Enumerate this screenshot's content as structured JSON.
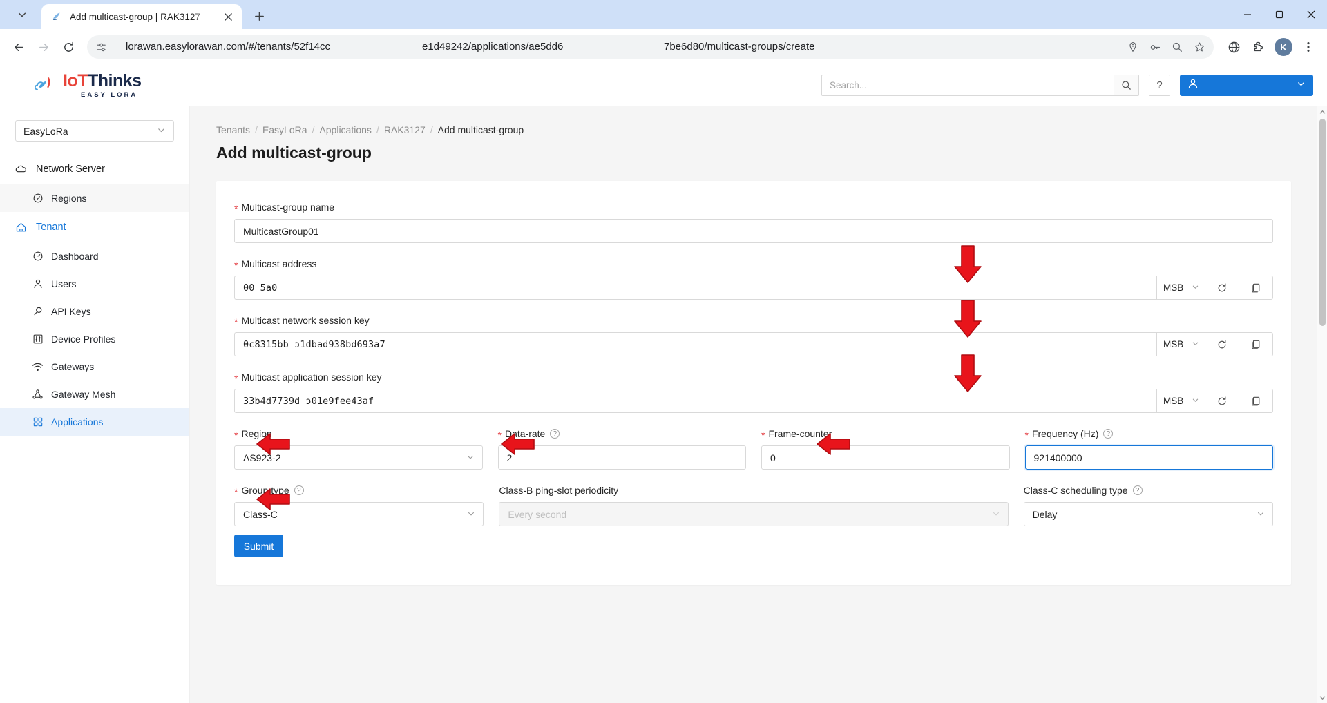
{
  "browser": {
    "tab": {
      "title": "Add multicast-group | RAK3127",
      "favicon_icon": "app-favicon"
    },
    "new_tab_label": "+",
    "window": {
      "minimize": "minimize-icon",
      "maximize": "maximize-icon",
      "close": "close-icon"
    },
    "nav": {
      "back": "back-arrow-icon",
      "forward": "forward-arrow-icon",
      "reload": "reload-icon"
    },
    "url": {
      "segment1": "lorawan.easylorawan.com/#/tenants/52f14cc",
      "segment2": "e1d49242/applications/ae5dd6",
      "segment3": "7be6d80/multicast-groups/create",
      "site_info_icon": "site-settings-icon"
    },
    "omnibox_icons": [
      "location-icon",
      "password-key-icon",
      "zoom-icon",
      "bookmark-star-icon"
    ],
    "toolbar_icons": [
      "globe-icon",
      "extensions-puzzle-icon"
    ],
    "profile": {
      "initial": "K"
    },
    "menu_icon": "three-dot-menu-icon"
  },
  "app": {
    "logo": {
      "main_part1": "IoT",
      "main_part2": "Thinks",
      "sub": "EASY LORA"
    },
    "search": {
      "placeholder": "Search...",
      "value": "",
      "button_icon": "search-icon"
    },
    "help_label": "?",
    "user_menu": {
      "avatar_icon": "user-icon",
      "chevron_icon": "chevron-down-icon"
    }
  },
  "sidebar": {
    "tenant_select": {
      "value": "EasyLoRa",
      "chevron_icon": "chevron-down-icon"
    },
    "groups": [
      {
        "label": "Network Server",
        "icon": "cloud-icon",
        "active": false,
        "items": [
          {
            "label": "Regions",
            "icon": "compass-icon",
            "selected": false,
            "highlight": true
          }
        ]
      },
      {
        "label": "Tenant",
        "icon": "home-icon",
        "active": true,
        "items": [
          {
            "label": "Dashboard",
            "icon": "gauge-icon",
            "selected": false,
            "highlight": false
          },
          {
            "label": "Users",
            "icon": "user-icon",
            "selected": false,
            "highlight": false
          },
          {
            "label": "API Keys",
            "icon": "key-search-icon",
            "selected": false,
            "highlight": false
          },
          {
            "label": "Device Profiles",
            "icon": "sliders-icon",
            "selected": false,
            "highlight": false
          },
          {
            "label": "Gateways",
            "icon": "wifi-icon",
            "selected": false,
            "highlight": false
          },
          {
            "label": "Gateway Mesh",
            "icon": "mesh-icon",
            "selected": false,
            "highlight": false
          },
          {
            "label": "Applications",
            "icon": "grid-apps-icon",
            "selected": true,
            "highlight": false
          }
        ]
      }
    ]
  },
  "main": {
    "breadcrumb": [
      "Tenants",
      "EasyLoRa",
      "Applications",
      "RAK3127",
      "Add multicast-group"
    ],
    "page_title": "Add multicast-group",
    "form": {
      "name": {
        "label": "Multicast-group name",
        "required": true,
        "value": "MulticastGroup01"
      },
      "address": {
        "label": "Multicast address",
        "required": true,
        "value": "00    5a0",
        "endian": "MSB",
        "regen_icon": "refresh-icon",
        "copy_icon": "copy-icon"
      },
      "nwk_session_key": {
        "label": "Multicast network session key",
        "required": true,
        "value": "0c8315bb           ɔ1dbad938bd693a7",
        "endian": "MSB",
        "regen_icon": "refresh-icon",
        "copy_icon": "copy-icon"
      },
      "app_session_key": {
        "label": "Multicast application session key",
        "required": true,
        "value": "33b4d7739d          ɔ01e9fee43af",
        "endian": "MSB",
        "regen_icon": "refresh-icon",
        "copy_icon": "copy-icon"
      },
      "region": {
        "label": "Region",
        "required": true,
        "value": "AS923-2",
        "chevron_icon": "chevron-down-icon"
      },
      "data_rate": {
        "label": "Data-rate",
        "required": true,
        "value": "2",
        "has_help": true
      },
      "frame_counter": {
        "label": "Frame-counter",
        "required": true,
        "value": "0",
        "has_help": false
      },
      "frequency": {
        "label": "Frequency (Hz)",
        "required": true,
        "value": "921400000",
        "has_help": true,
        "focused": true
      },
      "group_type": {
        "label": "Group type",
        "required": true,
        "value": "Class-C",
        "has_help": true,
        "chevron_icon": "chevron-down-icon"
      },
      "ping_slot_periodicity": {
        "label": "Class-B ping-slot periodicity",
        "required": false,
        "value": "Every second",
        "disabled": true,
        "chevron_icon": "chevron-down-icon"
      },
      "scheduling_type": {
        "label": "Class-C scheduling type",
        "required": false,
        "value": "Delay",
        "has_help": true,
        "chevron_icon": "chevron-down-icon"
      },
      "submit_label": "Submit"
    },
    "annotations": {
      "color": "#e8141b",
      "arrows": [
        {
          "name": "arrow-address-regenerate",
          "direction": "down"
        },
        {
          "name": "arrow-nwk-key-regenerate",
          "direction": "down"
        },
        {
          "name": "arrow-app-key-regenerate",
          "direction": "down"
        },
        {
          "name": "arrow-region",
          "direction": "left"
        },
        {
          "name": "arrow-data-rate",
          "direction": "left"
        },
        {
          "name": "arrow-frequency",
          "direction": "left"
        },
        {
          "name": "arrow-group-type",
          "direction": "left"
        }
      ]
    }
  }
}
